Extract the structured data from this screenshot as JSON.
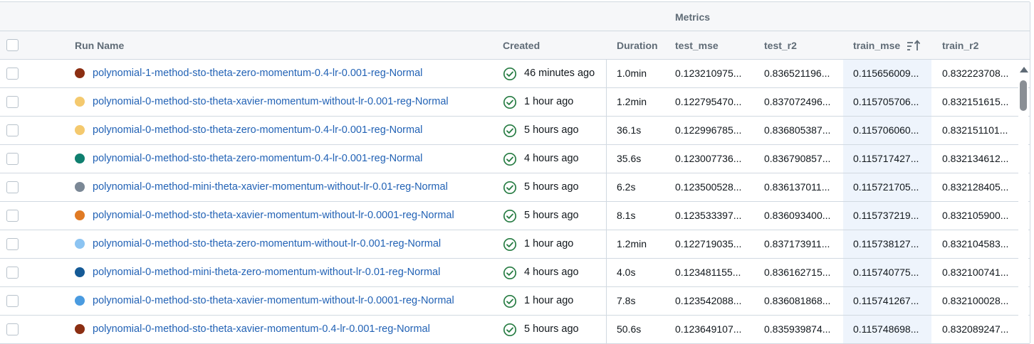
{
  "header": {
    "group_label": "Metrics",
    "columns": {
      "run_name": "Run Name",
      "created": "Created",
      "duration": "Duration",
      "test_mse": "test_mse",
      "test_r2": "test_r2",
      "train_mse": "train_mse",
      "train_r2": "train_r2"
    },
    "sort_icon": "sort-ascending-icon"
  },
  "status_icon": "check-circle-icon",
  "colors": {
    "link": "#2262b5",
    "success": "#277c43",
    "sorted_column_bg": "#eef4fc",
    "border": "#d1d9e1"
  },
  "rows": [
    {
      "color": "#8b2e12",
      "run_name": "polynomial-1-method-sto-theta-zero-momentum-0.4-lr-0.001-reg-Normal",
      "created": "46 minutes ago",
      "duration": "1.0min",
      "test_mse": "0.123210975...",
      "test_r2": "0.836521196...",
      "train_mse": "0.115656009...",
      "train_r2": "0.832223708..."
    },
    {
      "color": "#f4c96e",
      "run_name": "polynomial-0-method-sto-theta-xavier-momentum-without-lr-0.001-reg-Normal",
      "created": "1 hour ago",
      "duration": "1.2min",
      "test_mse": "0.122795470...",
      "test_r2": "0.837072496...",
      "train_mse": "0.115705706...",
      "train_r2": "0.832151615..."
    },
    {
      "color": "#f4c96e",
      "run_name": "polynomial-0-method-sto-theta-zero-momentum-0.4-lr-0.001-reg-Normal",
      "created": "5 hours ago",
      "duration": "36.1s",
      "test_mse": "0.122996785...",
      "test_r2": "0.836805387...",
      "train_mse": "0.115706060...",
      "train_r2": "0.832151101..."
    },
    {
      "color": "#0f7f6f",
      "run_name": "polynomial-0-method-sto-theta-zero-momentum-0.4-lr-0.001-reg-Normal",
      "created": "4 hours ago",
      "duration": "35.6s",
      "test_mse": "0.123007736...",
      "test_r2": "0.836790857...",
      "train_mse": "0.115717427...",
      "train_r2": "0.832134612..."
    },
    {
      "color": "#7b8896",
      "run_name": "polynomial-0-method-mini-theta-xavier-momentum-without-lr-0.01-reg-Normal",
      "created": "5 hours ago",
      "duration": "6.2s",
      "test_mse": "0.123500528...",
      "test_r2": "0.836137011...",
      "train_mse": "0.115721705...",
      "train_r2": "0.832128405..."
    },
    {
      "color": "#e07a24",
      "run_name": "polynomial-0-method-sto-theta-xavier-momentum-without-lr-0.0001-reg-Normal",
      "created": "5 hours ago",
      "duration": "8.1s",
      "test_mse": "0.123533397...",
      "test_r2": "0.836093400...",
      "train_mse": "0.115737219...",
      "train_r2": "0.832105900..."
    },
    {
      "color": "#8cc4f2",
      "run_name": "polynomial-0-method-sto-theta-zero-momentum-without-lr-0.001-reg-Normal",
      "created": "1 hour ago",
      "duration": "1.2min",
      "test_mse": "0.122719035...",
      "test_r2": "0.837173911...",
      "train_mse": "0.115738127...",
      "train_r2": "0.832104583..."
    },
    {
      "color": "#155a96",
      "run_name": "polynomial-0-method-mini-theta-zero-momentum-without-lr-0.01-reg-Normal",
      "created": "4 hours ago",
      "duration": "4.0s",
      "test_mse": "0.123481155...",
      "test_r2": "0.836162715...",
      "train_mse": "0.115740775...",
      "train_r2": "0.832100741..."
    },
    {
      "color": "#4a9be0",
      "run_name": "polynomial-0-method-sto-theta-xavier-momentum-without-lr-0.0001-reg-Normal",
      "created": "1 hour ago",
      "duration": "7.8s",
      "test_mse": "0.123542088...",
      "test_r2": "0.836081868...",
      "train_mse": "0.115741267...",
      "train_r2": "0.832100028..."
    },
    {
      "color": "#8b2e12",
      "run_name": "polynomial-0-method-sto-theta-xavier-momentum-0.4-lr-0.001-reg-Normal",
      "created": "5 hours ago",
      "duration": "50.6s",
      "test_mse": "0.123649107...",
      "test_r2": "0.835939874...",
      "train_mse": "0.115748698...",
      "train_r2": "0.832089247..."
    }
  ]
}
